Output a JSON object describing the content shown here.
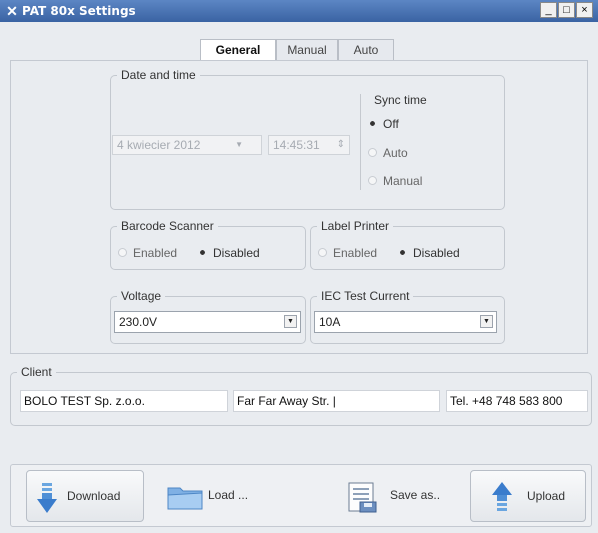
{
  "window": {
    "title": "PAT 80x Settings",
    "controls": {
      "minimize": "_",
      "maximize": "□",
      "close": "×"
    }
  },
  "tabs": [
    {
      "label": "General"
    },
    {
      "label": "Manual"
    },
    {
      "label": "Auto"
    }
  ],
  "date_time": {
    "legend": "Date and time",
    "date": "4 kwiecier 2012",
    "time": "14:45:31",
    "sync": {
      "title": "Sync time",
      "options": [
        "Off",
        "Auto",
        "Manual"
      ],
      "selected": "Off"
    }
  },
  "barcode": {
    "legend": "Barcode Scanner",
    "options": [
      "Enabled",
      "Disabled"
    ],
    "selected": "Disabled"
  },
  "label_printer": {
    "legend": "Label Printer",
    "options": [
      "Enabled",
      "Disabled"
    ],
    "selected": "Disabled"
  },
  "voltage": {
    "legend": "Voltage",
    "value": "230.0V"
  },
  "iec": {
    "legend": "IEC Test Current",
    "value": "10A"
  },
  "client": {
    "legend": "Client",
    "name": "BOLO TEST Sp. z.o.o.",
    "address": "Far Far Away Str. |",
    "phone": "Tel. +48 748 583 800"
  },
  "buttons": {
    "download": "Download",
    "load": "Load ...",
    "save": "Save as..",
    "upload": "Upload"
  },
  "icons": {
    "app": "pat-logo-icon",
    "download": "download-arrow-icon",
    "load": "folder-icon",
    "save": "save-document-icon",
    "upload": "upload-arrow-icon"
  }
}
